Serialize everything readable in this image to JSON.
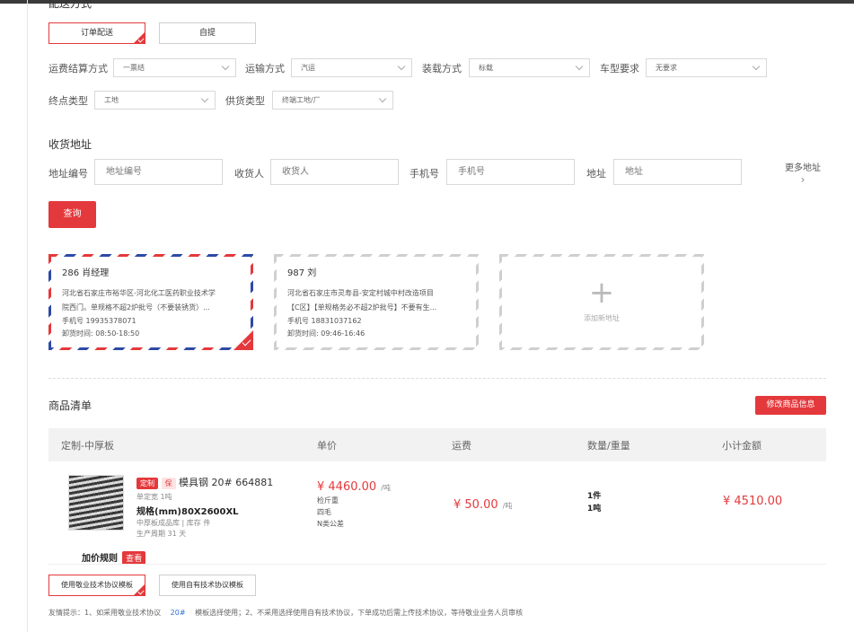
{
  "delivery": {
    "title": "配送方式",
    "options": [
      "订单配送",
      "自提"
    ],
    "fields": [
      {
        "label": "运费结算方式",
        "value": "一票结"
      },
      {
        "label": "运输方式",
        "value": "汽运"
      },
      {
        "label": "装载方式",
        "value": "标载"
      },
      {
        "label": "车型要求",
        "value": "无要求"
      },
      {
        "label": "终点类型",
        "value": "工地"
      },
      {
        "label": "供货类型",
        "value": "终端工地/厂"
      }
    ]
  },
  "address": {
    "title": "收货地址",
    "filters": [
      {
        "label": "地址编号",
        "placeholder": "地址编号"
      },
      {
        "label": "收货人",
        "placeholder": "收货人"
      },
      {
        "label": "手机号",
        "placeholder": "手机号"
      },
      {
        "label": "地址",
        "placeholder": "地址"
      }
    ],
    "more": "更多地址",
    "query_button": "查询",
    "cards": [
      {
        "name": "286  肖经理",
        "addr1": "河北省石家庄市裕华区-河北化工医药职业技术学",
        "addr2": "院西门。单规格不超2炉批号（不要装锈货）...",
        "phone": "手机号 19935378071",
        "time": "卸货时间:   08:50-18:50"
      },
      {
        "name": "987  刘",
        "addr1": "河北省石家庄市灵寿县-安定村城中村改造项目",
        "addr2": "【C区】【单规格务必不超2炉批号】不要有生...",
        "phone": "手机号 18831037162",
        "time": "卸货时间:   09:46-16:46"
      }
    ],
    "add_label": "添加新地址"
  },
  "goods": {
    "title": "商品清单",
    "edit_button": "修改商品信息",
    "columns": [
      "定制-中厚板",
      "单价",
      "运费",
      "数量/重量",
      "小计金额"
    ],
    "item": {
      "tag_custom": "定制",
      "tag_guarantee": "保",
      "name": "模具钢 20# 664881",
      "min_qty": "单定宽 1吨",
      "spec": "规格(mm)80X2600XL",
      "warehouse": "中厚板成品库 | 库存 件",
      "cycle": "生产周期 31 天",
      "price": "¥ 4460.00",
      "price_unit": "/吨",
      "weigh": "检斤重",
      "edge": "四毛",
      "tolerance": "N类公差",
      "freight": "¥ 50.00",
      "freight_unit": "/吨",
      "qty": "1件",
      "weight": "1吨",
      "subtotal": "¥ 4510.00"
    },
    "pricing_rule": "加价规则",
    "pricing_view": "查看"
  },
  "agreement": {
    "options": [
      "使用敬业技术协议模板",
      "使用自有技术协议模板"
    ],
    "tip_before": "友情提示：1、如采用敬业技术协议",
    "tip_highlight": "20#",
    "tip_after": "模板选择使用；2、不采用选择使用自有技术协议，下单成功后需上传技术协议，等待敬业业务人员审核"
  },
  "colors": {
    "accent": "#e4393c",
    "airmail_blue": "#2d4aa6",
    "link": "#2d6fd8"
  }
}
